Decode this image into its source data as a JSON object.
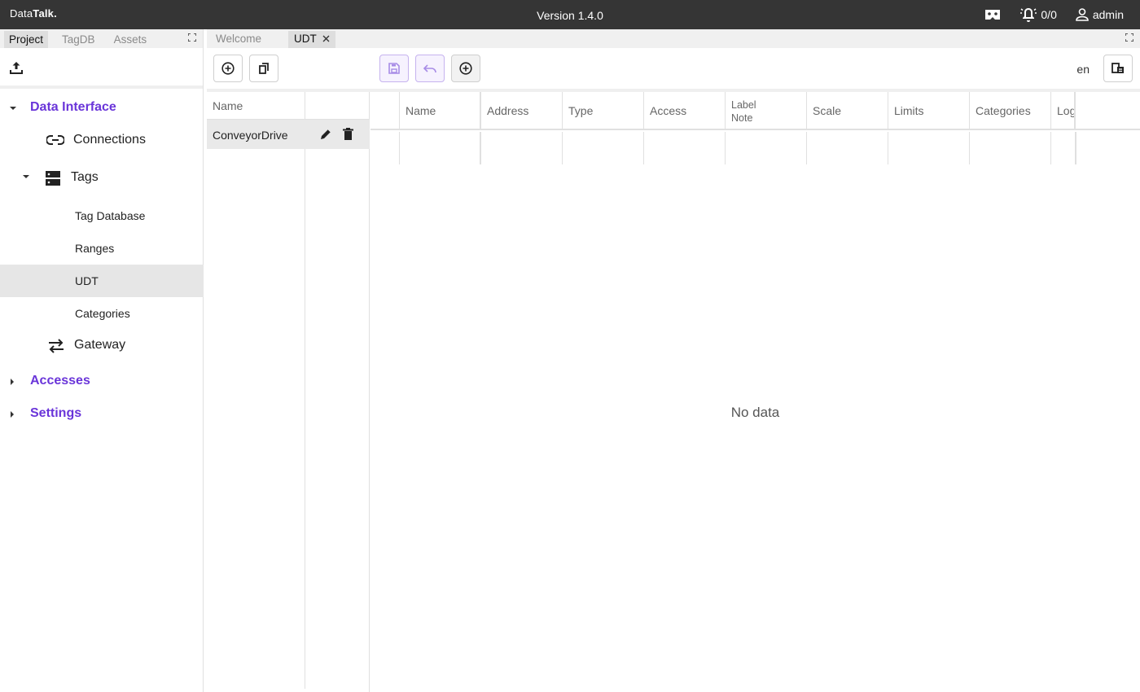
{
  "topbar": {
    "brand_prefix": "Data",
    "brand_bold": "Talk.",
    "version": "Version 1.4.0",
    "alarm_count": "0/0",
    "user": "admin"
  },
  "left_panel": {
    "tabs": [
      {
        "label": "Project",
        "active": true
      },
      {
        "label": "TagDB",
        "active": false
      },
      {
        "label": "Assets",
        "active": false
      }
    ],
    "tree": {
      "data_interface": "Data Interface",
      "connections": "Connections",
      "tags": "Tags",
      "tag_database": "Tag Database",
      "ranges": "Ranges",
      "udt": "UDT",
      "categories": "Categories",
      "gateway": "Gateway",
      "accesses": "Accesses",
      "settings": "Settings"
    }
  },
  "doc_tabs": [
    {
      "label": "Welcome",
      "active": false
    },
    {
      "label": "UDT",
      "active": true,
      "closable": true
    }
  ],
  "udt_list": {
    "header": "Name",
    "rows": [
      {
        "name": "ConveyorDrive"
      }
    ]
  },
  "grid": {
    "columns": [
      "Name",
      "Address",
      "Type",
      "Access",
      "Label",
      "Note",
      "Scale",
      "Limits",
      "Categories",
      "Log"
    ],
    "empty_text": "No data"
  },
  "toolbar": {
    "lang": "en"
  },
  "colors": {
    "topbar_bg": "#353535",
    "accent": "#6a35d9"
  }
}
